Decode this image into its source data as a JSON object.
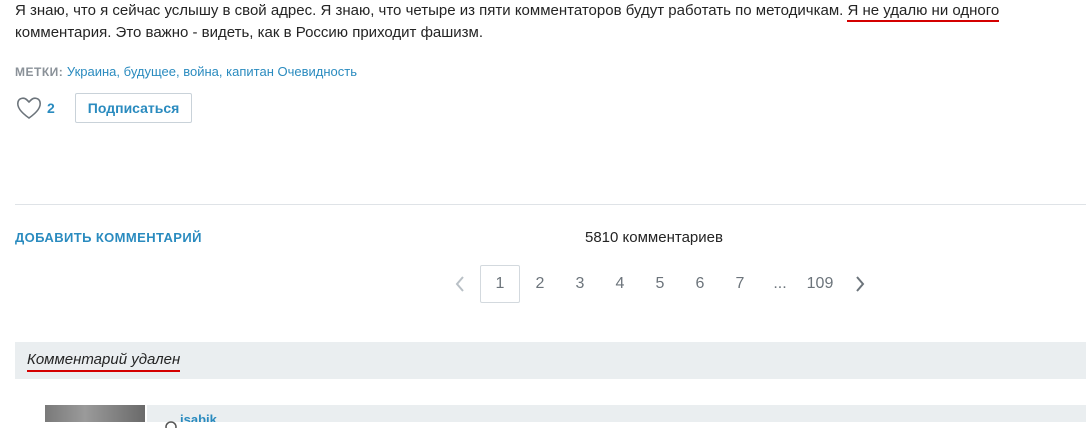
{
  "article": {
    "text_part1": "Я знаю, что я сейчас услышу в свой адрес. Я знаю, что четыре из пяти комментаторов будут работать по методичкам. ",
    "text_underlined": "Я не удалю ни одного",
    "text_part2": "комментария. Это важно - видеть, как в Россию приходит фашизм."
  },
  "tags": {
    "label": "МЕТКИ:",
    "items": [
      "Украина",
      "будущее",
      "война",
      "капитан Очевидность"
    ]
  },
  "likes": {
    "count": "2",
    "icon": "heart-icon"
  },
  "subscribe_label": "Подписаться",
  "comments": {
    "add_label": "ДОБАВИТЬ КОММЕНТАРИЙ",
    "count_label": "5810 комментариев"
  },
  "pagination": {
    "pages": [
      "1",
      "2",
      "3",
      "4",
      "5",
      "6",
      "7",
      "...",
      "109"
    ],
    "current": "1"
  },
  "deleted_comment": {
    "label": "Комментарий удален"
  },
  "next_comment": {
    "username": "isabik",
    "icon": "user-icon"
  },
  "colors": {
    "accent": "#2a8bbf",
    "underline": "#d40000",
    "bar_bg": "#eaeef0"
  }
}
